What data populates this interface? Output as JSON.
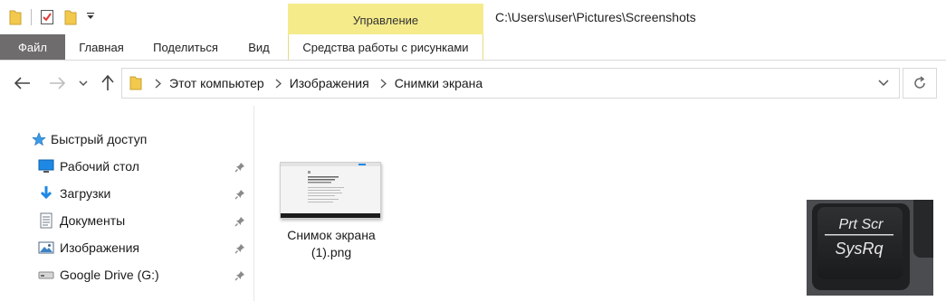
{
  "window": {
    "context_tab_header": "Управление",
    "title_path": "C:\\Users\\user\\Pictures\\Screenshots"
  },
  "quick_access_toolbar": {
    "icons": [
      "folder-icon",
      "properties-icon",
      "new-folder-icon",
      "customize-arrow-icon"
    ]
  },
  "ribbon": {
    "tabs": [
      {
        "label": "Файл"
      },
      {
        "label": "Главная"
      },
      {
        "label": "Поделиться"
      },
      {
        "label": "Вид"
      },
      {
        "label": "Средства работы с рисунками"
      }
    ]
  },
  "address_bar": {
    "breadcrumbs": [
      {
        "label": "Этот компьютер"
      },
      {
        "label": "Изображения"
      },
      {
        "label": "Снимки экрана"
      }
    ]
  },
  "navigation_pane": {
    "quick_access": {
      "label": "Быстрый доступ",
      "icon": "star-icon"
    },
    "items": [
      {
        "label": "Рабочий стол",
        "icon": "desktop-icon",
        "pinned": true
      },
      {
        "label": "Загрузки",
        "icon": "download-icon",
        "pinned": true
      },
      {
        "label": "Документы",
        "icon": "documents-icon",
        "pinned": true
      },
      {
        "label": "Изображения",
        "icon": "pictures-icon",
        "pinned": true
      },
      {
        "label": "Google Drive (G:)",
        "icon": "drive-icon",
        "pinned": true
      }
    ]
  },
  "files": [
    {
      "name": "Снимок экрана (1).png"
    }
  ],
  "preview": {
    "key_top": "Prt Scr",
    "key_bottom": "SysRq"
  },
  "colors": {
    "file_tab": "#6e6c6c",
    "context_tab": "#f5eb8b",
    "folder": "#f2c94c",
    "accent_blue": "#1e88e5"
  }
}
